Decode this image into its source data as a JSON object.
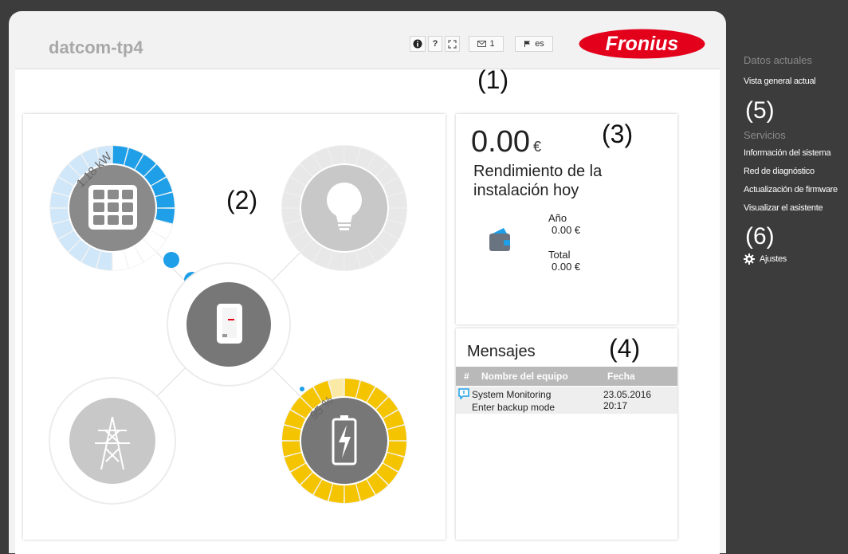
{
  "header": {
    "device_name": "datcom-tp4",
    "info_icon": "info-icon",
    "help_label": "?",
    "fullscreen_icon": "fullscreen-icon",
    "messages_count": "1",
    "language_label": "es",
    "logo_text": "Fronius"
  },
  "callouts": {
    "c1": "(1)",
    "c2": "(2)",
    "c3": "(3)",
    "c4": "(4)",
    "c5": "(5)",
    "c6": "(6)"
  },
  "flow": {
    "pv_power": "1.18 kW",
    "pv_level": 0.3,
    "battery_soc": "95 %",
    "battery_level": 0.95,
    "colors": {
      "pv": "#1e9fe8",
      "pv_light": "#cfe7f8",
      "battery": "#f5c400",
      "battery_light": "#fbeaa5",
      "inactive": "#e6e6e6",
      "gray": "#888888"
    }
  },
  "yield": {
    "today_value": "0.00",
    "currency": "€",
    "today_label": "Rendimiento de la instalación hoy",
    "year_label": "Año",
    "year_value": "0.00 €",
    "total_label": "Total",
    "total_value": "0.00 €"
  },
  "messages": {
    "title": "Mensajes",
    "columns": [
      "#",
      "Nombre del equipo",
      "Fecha"
    ],
    "rows": [
      {
        "device": "System Monitoring",
        "date": "23.05.2016 20:17",
        "text": "Enter backup mode"
      }
    ]
  },
  "sidebar": {
    "current_heading": "Datos actuales",
    "current_items": [
      "Vista general actual"
    ],
    "services_heading": "Servicios",
    "services_items": [
      "Información del sistema",
      "Red de diagnóstico",
      "Actualización de firmware",
      "Visualizar el asistente"
    ],
    "settings_label": "Ajustes"
  }
}
